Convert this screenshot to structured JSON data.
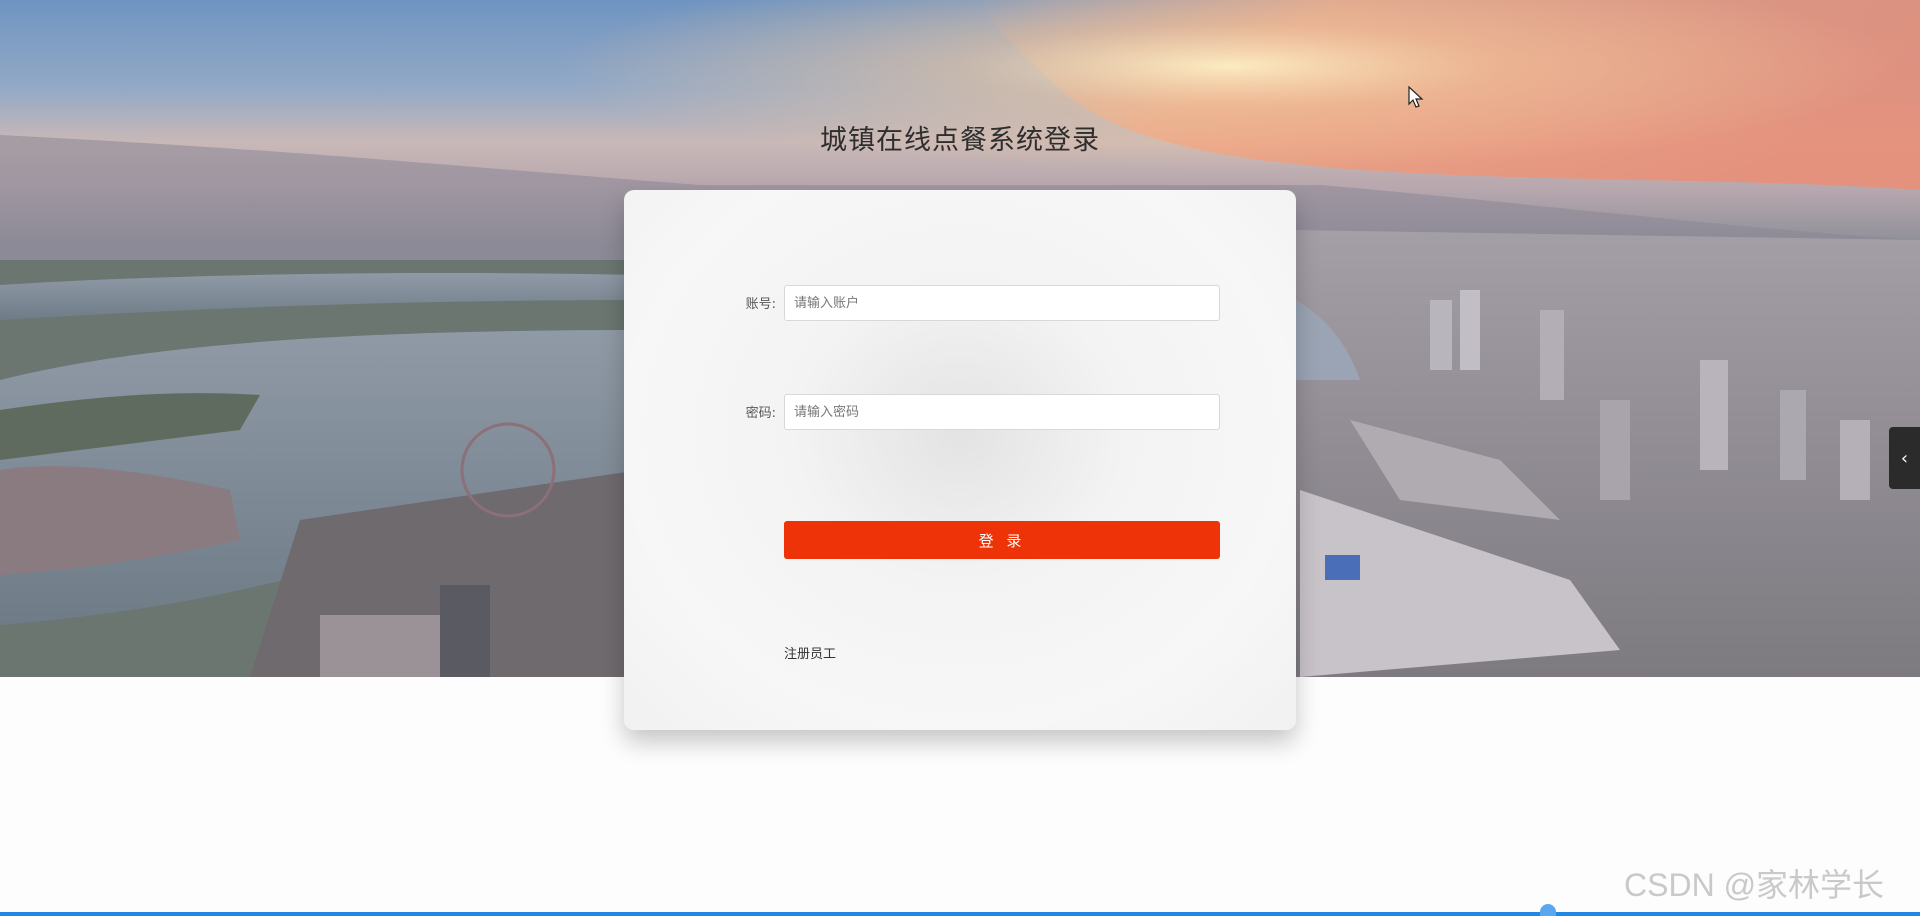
{
  "page": {
    "title": "城镇在线点餐系统登录"
  },
  "form": {
    "account_label": "账号:",
    "account_placeholder": "请输入账户",
    "password_label": "密码:",
    "password_placeholder": "请输入密码",
    "login_label": "登 录",
    "register_label": "注册员工"
  },
  "side_toggle": {
    "icon": "chevron-left-icon",
    "glyph": "‹"
  },
  "watermark": {
    "text": "CSDN @家林学长"
  },
  "colors": {
    "primary_button": "#ef3308",
    "accent_bar": "#1e88e5"
  }
}
